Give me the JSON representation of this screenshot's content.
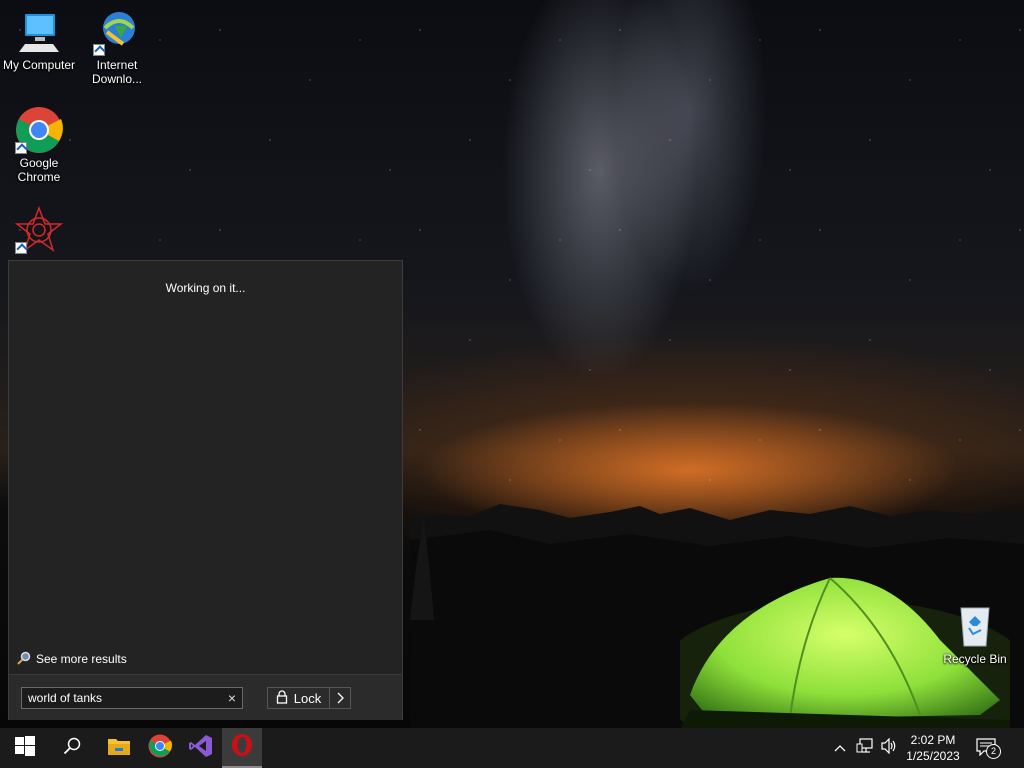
{
  "desktop": {
    "icons": [
      {
        "label": "My Computer"
      },
      {
        "label": "Internet Downlo..."
      },
      {
        "label": "Google Chrome"
      },
      {
        "label": ""
      },
      {
        "label": "Recycle Bin"
      }
    ]
  },
  "search": {
    "status": "Working on it...",
    "see_more": "See more results",
    "query": "world of tanks",
    "clear_icon": "×",
    "power_label": "Lock"
  },
  "taskbar": {
    "time": "2:02 PM",
    "date": "1/25/2023",
    "notification_count": "2",
    "pinned": [
      "start-icon",
      "search-icon",
      "file-explorer-icon",
      "chrome-icon",
      "visual-studio-icon",
      "opera-icon"
    ]
  },
  "colors": {
    "panel_bg": "#232323",
    "taskbar_bg": "#1b1b1b",
    "tent_green": "#8ee03a",
    "horizon_orange": "#e07a2a"
  }
}
